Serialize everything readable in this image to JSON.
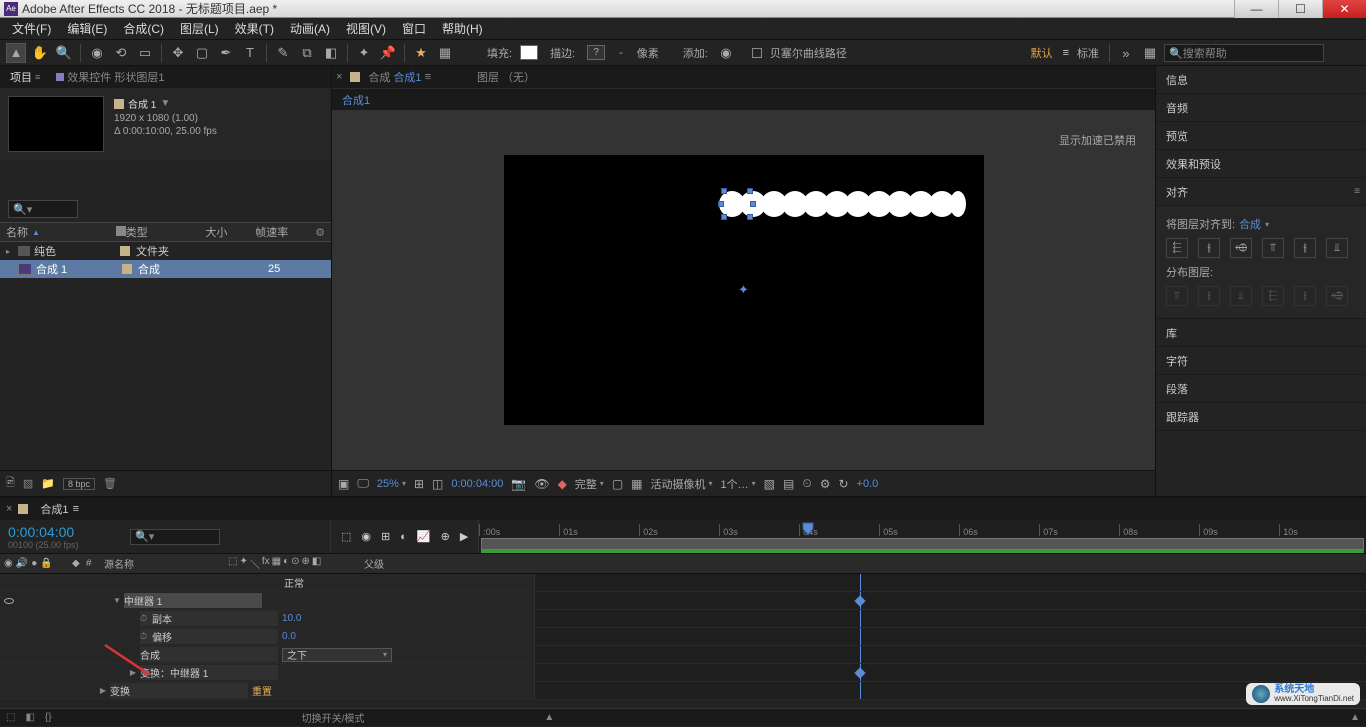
{
  "title_bar": {
    "app_icon_text": "Ae",
    "title": "Adobe After Effects CC 2018 - 无标题项目.aep *"
  },
  "menu": {
    "file": "文件(F)",
    "edit": "编辑(E)",
    "composition": "合成(C)",
    "layer": "图层(L)",
    "effect": "效果(T)",
    "animation": "动画(A)",
    "view": "视图(V)",
    "window": "窗口",
    "help": "帮助(H)"
  },
  "toolbar": {
    "fill_label": "填充:",
    "stroke_label": "描边:",
    "stroke_unknown": "?",
    "px_separator": "-",
    "px_label": "像素",
    "add_label": "添加:",
    "bezier_label": "贝塞尔曲线路径",
    "workspace_default": "默认",
    "workspace_standard": "标准",
    "search_placeholder": "搜索帮助"
  },
  "project_panel": {
    "tab_project": "项目",
    "tab_effects": "效果控件 形状图层1",
    "comp_name": "合成 1",
    "comp_dims": "1920 x 1080 (1.00)",
    "comp_dur": "Δ 0:00:10:00, 25.00 fps",
    "col_name": "名称",
    "col_type": "类型",
    "col_size": "大小",
    "col_fps": "帧速率",
    "row_solids": "纯色",
    "row_solids_type": "文件夹",
    "row_comp": "合成 1",
    "row_comp_type": "合成",
    "row_comp_fps": "25",
    "bpc": "8 bpc"
  },
  "comp_panel": {
    "tab_prefix": "合成",
    "tab_name": "合成1",
    "layer_label": "图层 （无）",
    "subtab": "合成1",
    "gpu_off": "显示加速已禁用",
    "controls": {
      "zoom": "25%",
      "time": "0:00:04:00",
      "res": "完整",
      "camera": "活动摄像机",
      "views": "1个…",
      "exposure": "+0.0"
    }
  },
  "right_panels": {
    "info": "信息",
    "audio": "音频",
    "preview": "预览",
    "effects_presets": "效果和预设",
    "align": "对齐",
    "align_label": "将图层对齐到:",
    "align_target": "合成",
    "distribute_label": "分布图层:",
    "library": "库",
    "character": "字符",
    "paragraph": "段落",
    "tracker": "跟踪器"
  },
  "timeline": {
    "tab_name": "合成1",
    "time": "0:00:04:00",
    "fps": "00100 (25.00 fps)",
    "col_num": "#",
    "col_src": "源名称",
    "col_parent": "父级",
    "seconds": [
      ":00s",
      "01s",
      "02s",
      "03s",
      "04s",
      "05s",
      "06s",
      "07s",
      "08s",
      "09s",
      "10s"
    ],
    "row_normal": "正常",
    "row_repeater": "中继器 1",
    "row_copies": "副本",
    "val_copies": "10.0",
    "row_offset": "偏移",
    "val_offset": "0.0",
    "row_composite": "合成",
    "val_composite": "之下",
    "row_transform_rep": "变换：中继器 1",
    "row_transform": "变换",
    "val_reset": "重置",
    "footer_switch": "切换开关/模式"
  },
  "watermark": {
    "line1": "系统天地",
    "line2": "www.XiTongTianDi.net"
  }
}
